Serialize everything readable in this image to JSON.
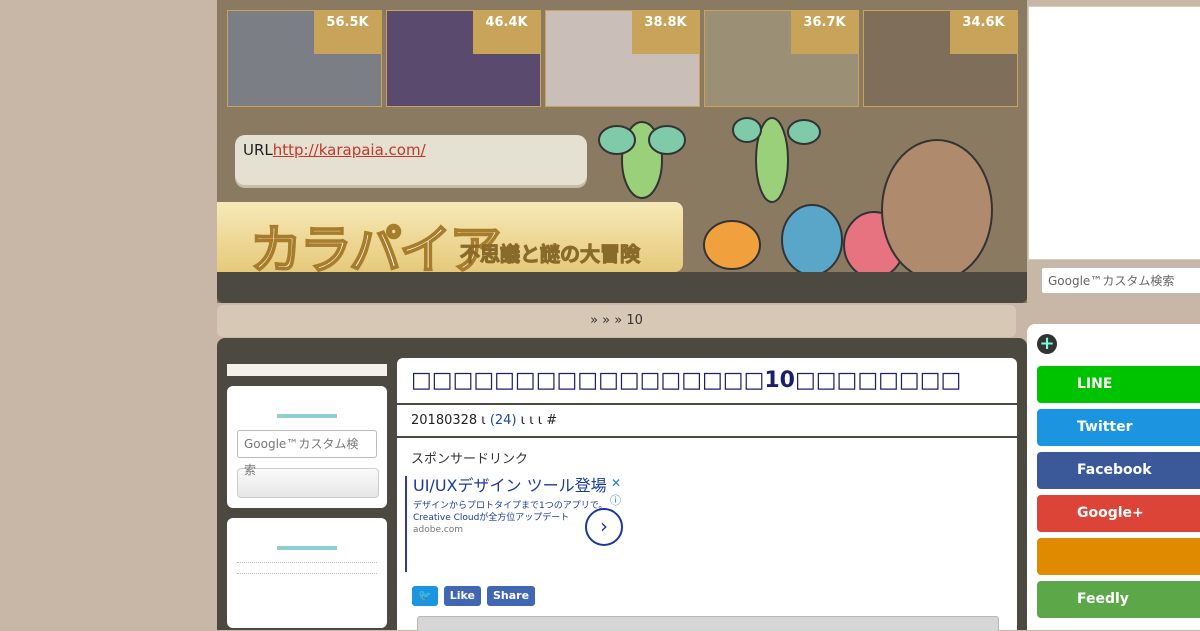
{
  "thumbnails": [
    {
      "count": "56.5K",
      "bg": "#7b7e84"
    },
    {
      "count": "46.4K",
      "bg": "#5a4b6e"
    },
    {
      "count": "38.8K",
      "bg": "#c9bfb8"
    },
    {
      "count": "36.7K",
      "bg": "#9b8f76"
    },
    {
      "count": "34.6K",
      "bg": "#7e6e5a"
    }
  ],
  "url_box": {
    "label": "URL",
    "link": "http://karapaia.com/"
  },
  "logo": {
    "title": "カラパイア",
    "subtitle": "不思議と謎の大冒険"
  },
  "breadcrumb": {
    "text": "»  »    » 10"
  },
  "article": {
    "title": "□□□□□□□□□□□□□□□□□10□□□□□□□□",
    "meta_date": "20180328 ι",
    "meta_count": "(24)",
    "meta_rest": " ι ι    ι #",
    "sponsored": "スポンサードリンク"
  },
  "ad": {
    "title": "UI/UXデザイン ツール登場",
    "desc": "デザインからプロトタイプまで1つのアプリで。Creative Cloudが全方位アップデート",
    "domain": "adobe.com",
    "close": "✕",
    "info": "ⓘ",
    "arrow": "›"
  },
  "share_buttons": {
    "twitter": "🐦",
    "like": "Like",
    "share": "Share"
  },
  "search": {
    "placeholder": "Google™カスタム検索"
  },
  "social": {
    "items": [
      {
        "label": "LINE",
        "color": "#00c300"
      },
      {
        "label": "Twitter",
        "color": "#1b95e0"
      },
      {
        "label": "Facebook",
        "color": "#3b5998"
      },
      {
        "label": "Google+",
        "color": "#db4437"
      },
      {
        "label": "",
        "color": "#e08a00"
      },
      {
        "label": "Feedly",
        "color": "#5ca849"
      }
    ]
  }
}
